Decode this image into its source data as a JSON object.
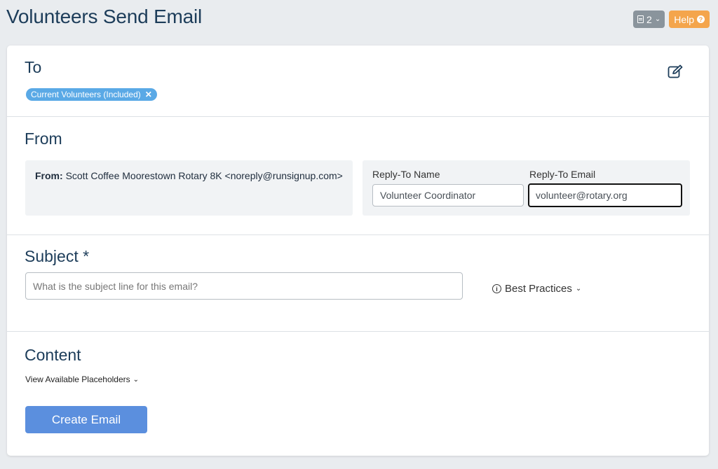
{
  "page": {
    "title": "Volunteers Send Email"
  },
  "top_actions": {
    "list_count": "2",
    "help_label": "Help"
  },
  "to": {
    "heading": "To",
    "tags": [
      {
        "label": "Current Volunteers (Included)"
      }
    ],
    "edit_icon": "edit-icon"
  },
  "from": {
    "heading": "From",
    "from_label": "From:",
    "from_value": "Scott Coffee Moorestown Rotary 8K <noreply@runsignup.com>",
    "reply_to_name_label": "Reply-To Name",
    "reply_to_name_value": "Volunteer Coordinator",
    "reply_to_email_label": "Reply-To Email",
    "reply_to_email_value": "volunteer@rotary.org"
  },
  "subject": {
    "heading": "Subject *",
    "placeholder": "What is the subject line for this email?",
    "best_practices_label": "Best Practices"
  },
  "content": {
    "heading": "Content",
    "placeholders_link": "View Available Placeholders",
    "create_button": "Create Email"
  },
  "colors": {
    "title": "#1d3d5a",
    "tag": "#5aa9e6",
    "help": "#f4a54c",
    "badge": "#8a949c",
    "primary_button": "#5b8fde"
  }
}
